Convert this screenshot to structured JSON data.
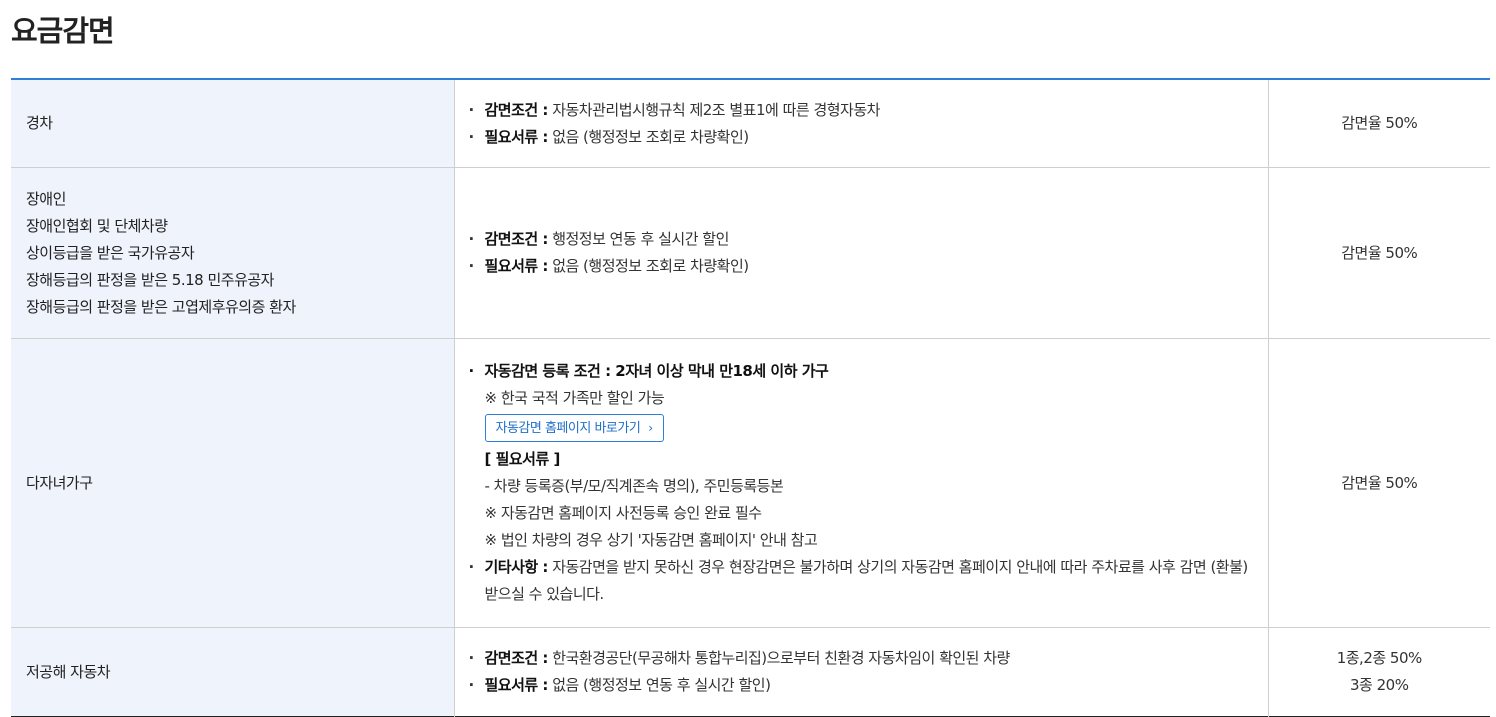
{
  "page": {
    "title": "요금감면"
  },
  "rows": [
    {
      "category": [
        "경차"
      ],
      "desc": {
        "cond_label": "감면조건 :",
        "cond_text": " 자동차관리법시행규칙 제2조 별표1에 따른 경형자동차",
        "doc_label": "필요서류 :",
        "doc_text": " 없음 (행정정보 조회로 차량확인)"
      },
      "rate": [
        "감면율 50%"
      ]
    },
    {
      "category": [
        "장애인",
        "장애인협회 및 단체차량",
        "상이등급을 받은 국가유공자",
        "장해등급의 판정을 받은 5.18 민주유공자",
        "장해등급의 판정을 받은 고엽제후유의증 환자"
      ],
      "desc": {
        "cond_label": "감면조건 :",
        "cond_text": " 행정정보 연동 후 실시간 할인",
        "doc_label": "필요서류 :",
        "doc_text": " 없음 (행정정보 조회로 차량확인)"
      },
      "rate": [
        "감면율 50%"
      ]
    },
    {
      "category": [
        "다자녀가구"
      ],
      "desc": {
        "auto_label": "자동감면 등록 조건 : 2자녀 이상 막내 만18세 이하 가구",
        "note_korean": "※ 한국 국적 가족만 할인 가능",
        "button_label": "자동감면 홈페이지 바로가기",
        "button_chevron": "›",
        "docs_header": "[ 필요서류 ]",
        "docs_line": "- 차량 등록증(부/모/직계존속 명의), 주민등록등본",
        "note_prereg": "※ 자동감면 홈페이지 사전등록 승인 완료 필수",
        "note_corp": "※ 법인 차량의 경우 상기 '자동감면 홈페이지' 안내 참고",
        "etc_label": "기타사항 :",
        "etc_text": " 자동감면을 받지 못하신 경우 현장감면은 불가하며 상기의 자동감면 홈페이지 안내에 따라 주차료를 사후 감면 (환불) 받으실 수 있습니다."
      },
      "rate": [
        "감면율 50%"
      ]
    },
    {
      "category": [
        "저공해 자동차"
      ],
      "desc": {
        "cond_label": "감면조건 :",
        "cond_text": " 한국환경공단(무공해차 통합누리집)으로부터 친환경 자동차임이 확인된 차량",
        "doc_label": "필요서류 :",
        "doc_text": " 없음 (행정정보 연동 후 실시간 할인)"
      },
      "rate": [
        "1종,2종 50%",
        "3종 20%"
      ]
    }
  ]
}
